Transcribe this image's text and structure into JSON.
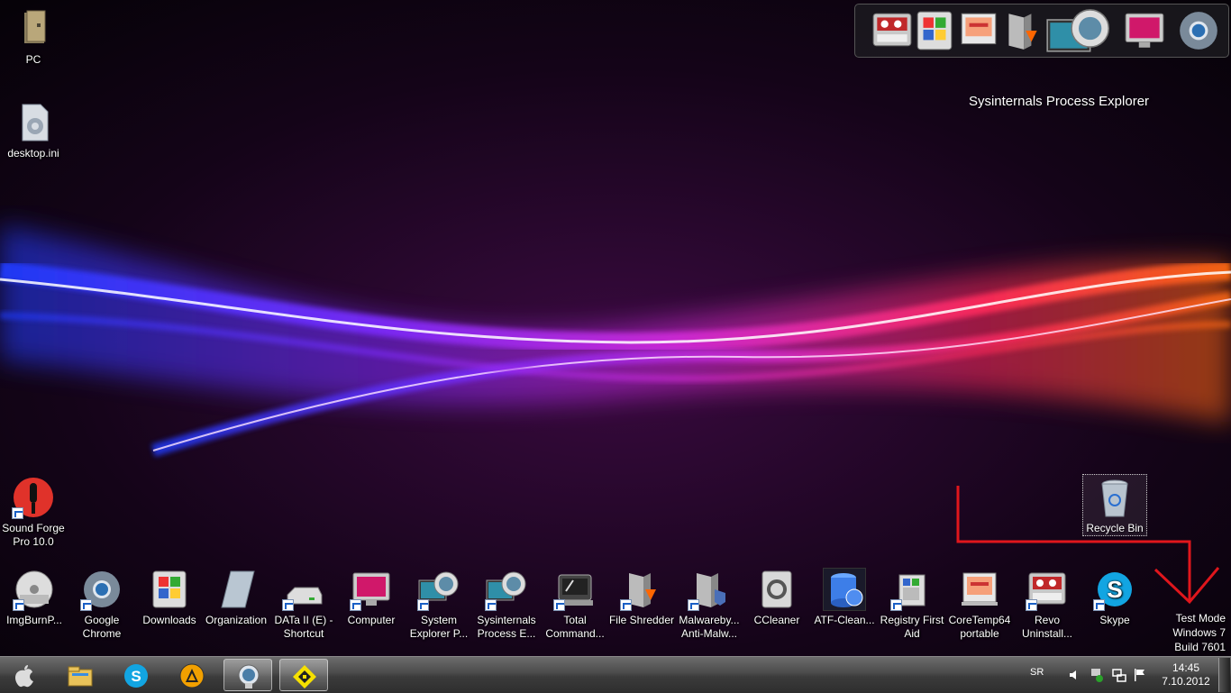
{
  "desktop": {
    "left_icons": [
      {
        "label": "PC",
        "icon": "folder-pc-icon"
      },
      {
        "label": "desktop.ini",
        "icon": "settings-file-icon"
      },
      {
        "label": "Sound Forge Pro 10.0",
        "icon": "sound-forge-icon"
      }
    ],
    "row_icons": [
      {
        "label": "ImgBurnP...",
        "icon": "imgburn-icon"
      },
      {
        "label": "Google Chrome",
        "icon": "chrome-icon"
      },
      {
        "label": "Downloads",
        "icon": "downloads-icon"
      },
      {
        "label": "Organization",
        "icon": "organization-icon"
      },
      {
        "label": "DATa II (E) - Shortcut",
        "icon": "drive-icon"
      },
      {
        "label": "Computer",
        "icon": "computer-icon"
      },
      {
        "label": "System Explorer P...",
        "icon": "system-explorer-icon"
      },
      {
        "label": "Sysinternals Process E...",
        "icon": "process-explorer-icon"
      },
      {
        "label": "Total Command...",
        "icon": "total-commander-icon"
      },
      {
        "label": "File Shredder",
        "icon": "file-shredder-icon"
      },
      {
        "label": "Malwareby... Anti-Malw...",
        "icon": "malwarebytes-icon"
      },
      {
        "label": "CCleaner",
        "icon": "ccleaner-icon"
      },
      {
        "label": "ATF-Clean...",
        "icon": "atf-cleaner-icon"
      },
      {
        "label": "Registry First Aid",
        "icon": "registry-icon"
      },
      {
        "label": "CoreTemp64 portable",
        "icon": "coretemp-icon"
      },
      {
        "label": "Revo Uninstall...",
        "icon": "revo-icon"
      },
      {
        "label": "Skype",
        "icon": "skype-icon"
      }
    ],
    "recycle_bin": {
      "label": "Recycle Bin",
      "icon": "recycle-bin-icon"
    },
    "watermark": {
      "line1": "Test Mode",
      "line2": "Windows 7",
      "line3": "Build 7601"
    }
  },
  "dock": {
    "tooltip": "Sysinternals Process Explorer",
    "items": [
      "control-panel-icon",
      "windows-explorer-icon",
      "coretemp-icon",
      "file-shredder-icon",
      "process-explorer-icon",
      "computer-icon",
      "chrome-icon"
    ]
  },
  "taskbar": {
    "items": [
      {
        "icon": "apple-start-icon",
        "active": false
      },
      {
        "icon": "file-explorer-icon",
        "active": false
      },
      {
        "icon": "skype-icon",
        "active": false
      },
      {
        "icon": "aimp-icon",
        "active": false
      },
      {
        "icon": "process-explorer-icon",
        "active": true
      },
      {
        "icon": "yellow-diamond-app-icon",
        "active": true
      }
    ],
    "language": "SR",
    "time": "14:45",
    "date": "7.10.2012"
  },
  "colors": {
    "annotation_arrow": "#e0161c",
    "taskbar": "#4a4a4a"
  }
}
